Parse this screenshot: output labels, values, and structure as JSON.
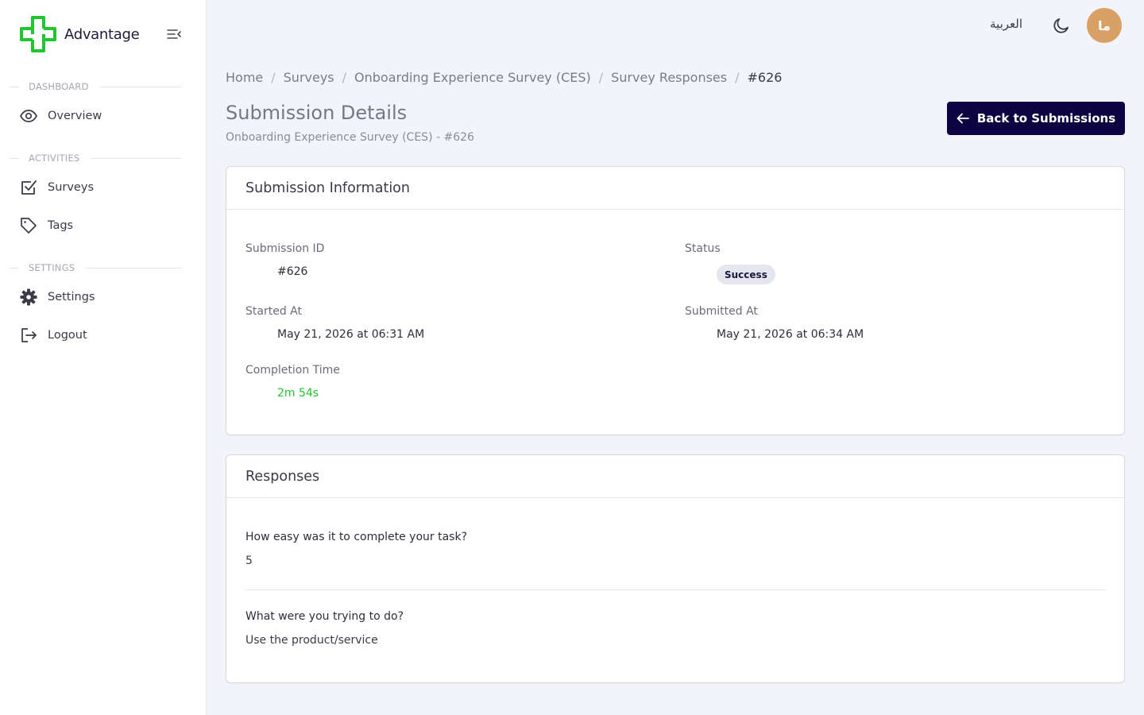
{
  "brand": {
    "name": "Advantage",
    "accent": "#22c52e"
  },
  "sidebar": {
    "sections": [
      {
        "label": "DASHBOARD"
      },
      {
        "label": "ACTIVITIES"
      },
      {
        "label": "SETTINGS"
      }
    ],
    "items": [
      {
        "label": "Overview",
        "icon": "eye-icon"
      },
      {
        "label": "Surveys",
        "icon": "checkbox-icon"
      },
      {
        "label": "Tags",
        "icon": "tag-icon"
      },
      {
        "label": "Settings",
        "icon": "gear-icon"
      },
      {
        "label": "Logout",
        "icon": "logout-icon"
      }
    ]
  },
  "topbar": {
    "language": "العربية",
    "avatar_initials": "ما",
    "avatar_color": "#d9a066"
  },
  "breadcrumb": [
    "Home",
    "Surveys",
    "Onboarding Experience Survey (CES)",
    "Survey Responses",
    "#626"
  ],
  "page": {
    "title": "Submission Details",
    "subtitle": "Onboarding Experience Survey (CES) - #626",
    "back_button": "Back to Submissions"
  },
  "submission_info": {
    "title": "Submission Information",
    "submission_id_label": "Submission ID",
    "submission_id": "#626",
    "status_label": "Status",
    "status": "Success",
    "started_at_label": "Started At",
    "started_at": "May 21, 2026 at 06:31 AM",
    "submitted_at_label": "Submitted At",
    "submitted_at": "May 21, 2026 at 06:34 AM",
    "completion_time_label": "Completion Time",
    "completion_time": "2m 54s"
  },
  "responses": {
    "title": "Responses",
    "items": [
      {
        "question": "How easy was it to complete your task?",
        "answer": "5"
      },
      {
        "question": "What were you trying to do?",
        "answer": "Use the product/service"
      }
    ]
  }
}
